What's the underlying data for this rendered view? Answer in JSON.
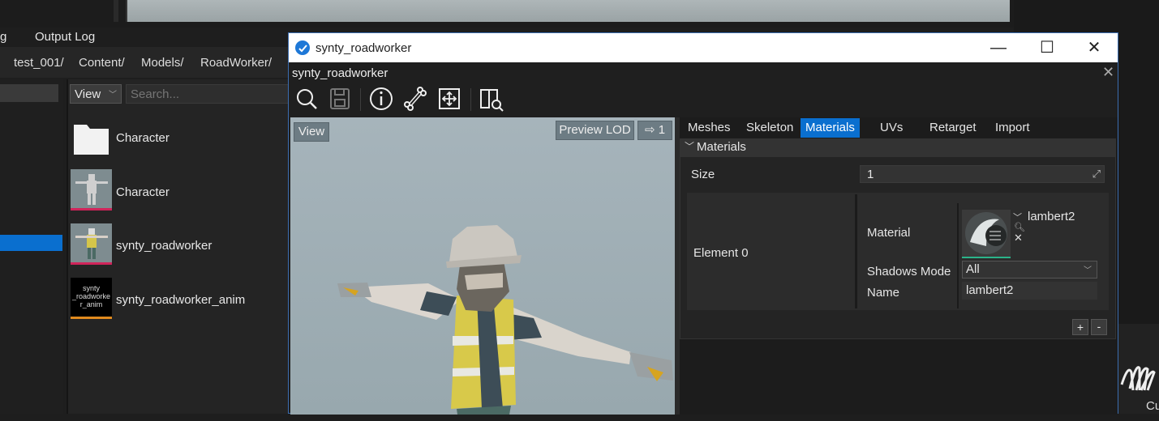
{
  "log_tabs": {
    "left": "g",
    "output": "Output Log"
  },
  "breadcrumb": [
    "test_001/",
    "Content/",
    "Models/",
    "RoadWorker/"
  ],
  "browser": {
    "view_label": "View",
    "search_placeholder": "Search...",
    "assets": [
      {
        "label": "Character",
        "kind": "folder"
      },
      {
        "label": "Character",
        "kind": "model"
      },
      {
        "label": "synty_roadworker",
        "kind": "model"
      },
      {
        "label": "synty_roadworker_anim",
        "kind": "anim",
        "thumb_text": "synty\n_roadworke\nr_anim"
      }
    ]
  },
  "window": {
    "title": "synty_roadworker",
    "subtitle": "synty_roadworker",
    "controls": {
      "minimize": "—",
      "maximize": "☐",
      "close": "✕"
    },
    "close_glyph": "✕"
  },
  "toolbar": [
    "search-icon",
    "save-icon",
    "info-icon",
    "bone-icon",
    "fit-view-icon",
    "docs-search-icon"
  ],
  "viewport": {
    "view_label": "View",
    "lod_label": "Preview LOD",
    "lod_value": "⇨ 1"
  },
  "props": {
    "tabs": [
      "Meshes",
      "Skeleton",
      "Materials",
      "UVs",
      "Retarget",
      "Import"
    ],
    "active_tab": "Materials",
    "group_title": "Materials",
    "size_label": "Size",
    "size_value": "1",
    "element_label": "Element 0",
    "material_label": "Material",
    "material_name": "lambert2",
    "shadows_label": "Shadows Mode",
    "shadows_value": "All",
    "name_label": "Name",
    "name_value": "lambert2",
    "plus": "+",
    "minus": "-"
  },
  "corner_text": "Cu"
}
